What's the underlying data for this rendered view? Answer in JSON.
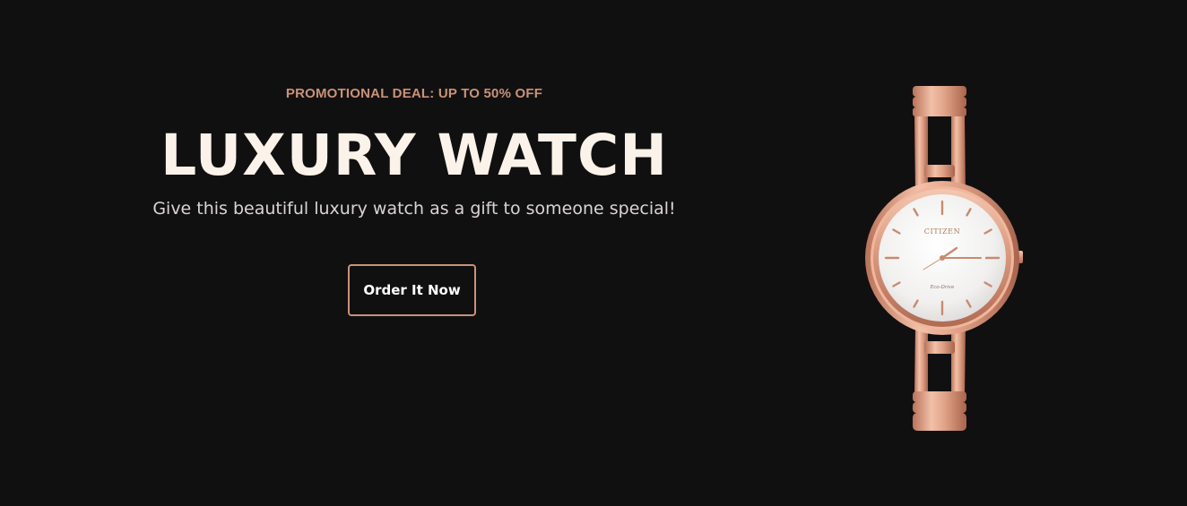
{
  "hero": {
    "promo": "PROMOTIONAL DEAL: UP TO 50% OFF",
    "title": "LUXURY WATCH",
    "subtitle": "Give this beautiful luxury watch as a gift to someone special!",
    "cta_label": "Order It Now"
  },
  "watch": {
    "brand": "CITIZEN",
    "dial_label": "Eco-Drive",
    "icon": "watch-image"
  },
  "colors": {
    "background": "#111011",
    "accent": "#c99278",
    "title": "#fbf3e9",
    "subtitle": "#d9d4d2",
    "rose_gold": "#e3a98e"
  }
}
